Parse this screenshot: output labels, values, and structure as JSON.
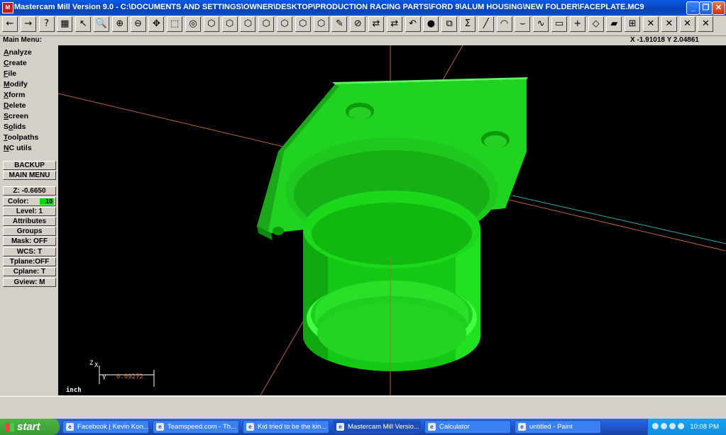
{
  "window": {
    "title": "Mastercam Mill Version 9.0 - C:\\DOCUMENTS AND SETTINGS\\OWNER\\DESKTOP\\PRODUCTION RACING PARTS\\FORD 9\\ALUM HOUSING\\NEW FOLDER\\FACEPLATE.MC9",
    "app_icon": "mastercam-icon",
    "controls": {
      "minimize": "_",
      "maximize": "❐",
      "close": "✕"
    }
  },
  "toolbar": {
    "items": [
      {
        "name": "back",
        "glyph": "←"
      },
      {
        "name": "forward",
        "glyph": "→"
      },
      {
        "name": "help",
        "glyph": "?"
      },
      {
        "name": "calculator",
        "glyph": "▦"
      },
      {
        "name": "analyze",
        "glyph": "↖"
      },
      {
        "name": "zoom-window",
        "glyph": "🔍"
      },
      {
        "name": "zoom-in",
        "glyph": "⊕"
      },
      {
        "name": "zoom-out",
        "glyph": "⊖"
      },
      {
        "name": "pan",
        "glyph": "✥"
      },
      {
        "name": "fit",
        "glyph": "⬚"
      },
      {
        "name": "repaint",
        "glyph": "◎"
      },
      {
        "name": "view-top",
        "glyph": "⬡"
      },
      {
        "name": "view-front",
        "glyph": "⬡"
      },
      {
        "name": "view-side",
        "glyph": "⬡"
      },
      {
        "name": "view-iso",
        "glyph": "⬡"
      },
      {
        "name": "cplane-top",
        "glyph": "⬡"
      },
      {
        "name": "cplane-front",
        "glyph": "⬡"
      },
      {
        "name": "cplane-side",
        "glyph": "⬡"
      },
      {
        "name": "measure",
        "glyph": "✎"
      },
      {
        "name": "delete",
        "glyph": "⊘"
      },
      {
        "name": "transform",
        "glyph": "⇄"
      },
      {
        "name": "transform-2",
        "glyph": "⇄"
      },
      {
        "name": "undo",
        "glyph": "↶"
      },
      {
        "name": "shade",
        "glyph": "●"
      },
      {
        "name": "groups",
        "glyph": "⧉"
      },
      {
        "name": "sum",
        "glyph": "Σ"
      },
      {
        "name": "line",
        "glyph": "╱"
      },
      {
        "name": "arc",
        "glyph": "◠"
      },
      {
        "name": "fillet",
        "glyph": "⌣"
      },
      {
        "name": "spline",
        "glyph": "∿"
      },
      {
        "name": "rectangle",
        "glyph": "▭"
      },
      {
        "name": "point",
        "glyph": "+"
      },
      {
        "name": "surface",
        "glyph": "◇"
      },
      {
        "name": "solid",
        "glyph": "▰"
      },
      {
        "name": "toolpath",
        "glyph": "⊞"
      },
      {
        "name": "trim-1",
        "glyph": "✕"
      },
      {
        "name": "trim-2",
        "glyph": "✕"
      },
      {
        "name": "trim-3",
        "glyph": "✕"
      },
      {
        "name": "trim-4",
        "glyph": "✕"
      }
    ]
  },
  "status": {
    "main_menu_label": "Main Menu:",
    "coords": "X -1.91018  Y 2.04861"
  },
  "main_menu": {
    "items": [
      {
        "key": "A",
        "rest": "nalyze"
      },
      {
        "key": "C",
        "rest": "reate"
      },
      {
        "key": "F",
        "rest": "ile"
      },
      {
        "key": "M",
        "rest": "odify"
      },
      {
        "key": "X",
        "rest": "form"
      },
      {
        "key": "D",
        "rest": "elete"
      },
      {
        "key": "S",
        "rest": "creen"
      },
      {
        "key": "",
        "rest": "S",
        "key2": "o",
        "rest2": "lids"
      },
      {
        "key": "T",
        "rest": "oolpaths"
      },
      {
        "key": "N",
        "rest": "C utils"
      }
    ]
  },
  "secondary_menu": {
    "backup": "BACKUP",
    "main_menu": "MAIN MENU",
    "z": "Z: -0.6650",
    "color_label": "Color:",
    "color_value": "10",
    "level": "Level:  1",
    "attributes": "Attributes",
    "groups": "Groups",
    "mask": "Mask:  OFF",
    "wcs": "WCS:   T",
    "tplane": "Tplane:OFF",
    "cplane": "Cplane:  T",
    "gview": "Gview:   M"
  },
  "viewport": {
    "axis_z": "Z",
    "axis_x": "X",
    "axis_y": "Y",
    "scale_value": "0.09272",
    "units": "inch",
    "part_color": "#00ff00",
    "background": "#000000"
  },
  "taskbar": {
    "start_label": "start",
    "tasks": [
      {
        "label": "Facebook | Kevin Kon...",
        "icon": "ie-icon"
      },
      {
        "label": "Teamspeed.com - Th...",
        "icon": "ie-icon"
      },
      {
        "label": "Kid tried to be the kin...",
        "icon": "ie-icon"
      },
      {
        "label": "Mastercam Mill Versio...",
        "icon": "mastercam-icon"
      },
      {
        "label": "Calculator",
        "icon": "calculator-icon"
      },
      {
        "label": "untitled - Paint",
        "icon": "paint-icon"
      }
    ],
    "clock": "10:08 PM"
  }
}
